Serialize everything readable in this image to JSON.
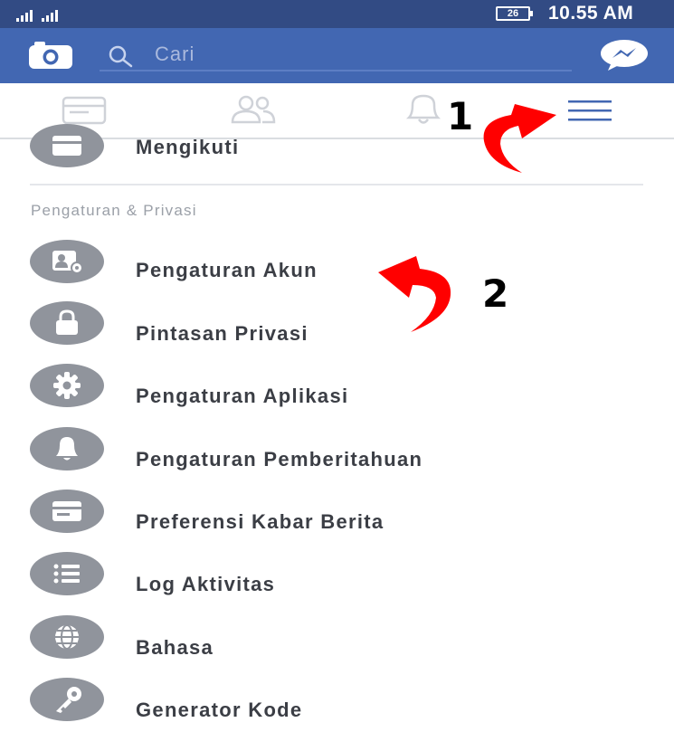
{
  "status_bar": {
    "time": "10.55 AM",
    "battery_level": "26",
    "signal_icons": [
      "signal-icon",
      "signal-icon"
    ]
  },
  "header": {
    "search_placeholder": "Cari",
    "left_icon": "camera-icon",
    "right_icon": "messenger-icon"
  },
  "tabs": [
    {
      "name": "news-feed-tab",
      "icon": "news-feed-icon"
    },
    {
      "name": "friends-tab",
      "icon": "friends-icon"
    },
    {
      "name": "notifications-tab",
      "icon": "bell-icon"
    },
    {
      "name": "menu-tab",
      "icon": "menu-icon",
      "active": true
    }
  ],
  "annotations": {
    "step1": "1",
    "step2": "2",
    "arrow_color": "#ff0000"
  },
  "menu": {
    "partial_item": {
      "label": "Mengikuti",
      "icon": "card-icon"
    },
    "section_title": "Pengaturan & Privasi",
    "items": [
      {
        "label": "Pengaturan Akun",
        "icon": "account-settings-icon"
      },
      {
        "label": "Pintasan Privasi",
        "icon": "lock-icon"
      },
      {
        "label": "Pengaturan Aplikasi",
        "icon": "gear-icon"
      },
      {
        "label": "Pengaturan Pemberitahuan",
        "icon": "bell-icon"
      },
      {
        "label": "Preferensi Kabar Berita",
        "icon": "card-icon"
      },
      {
        "label": "Log Aktivitas",
        "icon": "list-icon"
      },
      {
        "label": "Bahasa",
        "icon": "globe-icon"
      },
      {
        "label": "Generator Kode",
        "icon": "key-icon"
      }
    ]
  },
  "colors": {
    "status_bar": "#324b84",
    "brand_blue": "#4267b2",
    "icon_circle": "#90949c",
    "annotation_red": "#ff0000"
  }
}
